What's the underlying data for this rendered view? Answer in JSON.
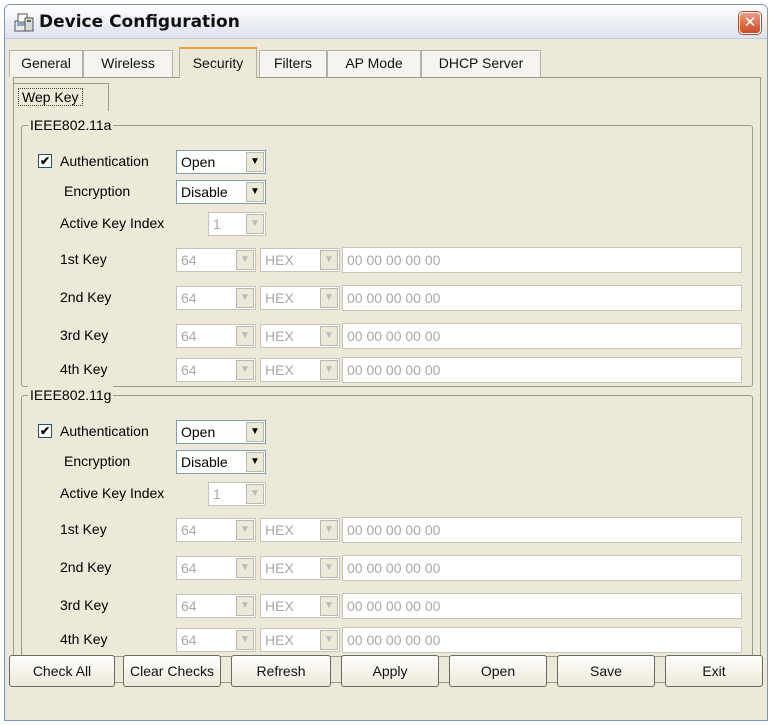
{
  "window": {
    "title": "Device Configuration"
  },
  "tabs": [
    "General",
    "Wireless",
    "Security",
    "Filters",
    "AP Mode",
    "DHCP Server"
  ],
  "active_tab": "Security",
  "subtab": "Wep Key",
  "groups": [
    {
      "title": "IEEE802.11a",
      "authentication_label": "Authentication",
      "authentication_checked": true,
      "authentication_value": "Open",
      "encryption_label": "Encryption",
      "encryption_value": "Disable",
      "active_key_index_label": "Active Key Index",
      "active_key_index_value": "1",
      "keys": [
        {
          "label": "1st Key",
          "length": "64",
          "format": "HEX",
          "value": "00 00 00 00 00"
        },
        {
          "label": "2nd Key",
          "length": "64",
          "format": "HEX",
          "value": "00 00 00 00 00"
        },
        {
          "label": "3rd Key",
          "length": "64",
          "format": "HEX",
          "value": "00 00 00 00 00"
        },
        {
          "label": "4th Key",
          "length": "64",
          "format": "HEX",
          "value": "00 00 00 00 00"
        }
      ]
    },
    {
      "title": "IEEE802.11g",
      "authentication_label": "Authentication",
      "authentication_checked": true,
      "authentication_value": "Open",
      "encryption_label": "Encryption",
      "encryption_value": "Disable",
      "active_key_index_label": "Active Key Index",
      "active_key_index_value": "1",
      "keys": [
        {
          "label": "1st Key",
          "length": "64",
          "format": "HEX",
          "value": "00 00 00 00 00"
        },
        {
          "label": "2nd Key",
          "length": "64",
          "format": "HEX",
          "value": "00 00 00 00 00"
        },
        {
          "label": "3rd Key",
          "length": "64",
          "format": "HEX",
          "value": "00 00 00 00 00"
        },
        {
          "label": "4th Key",
          "length": "64",
          "format": "HEX",
          "value": "00 00 00 00 00"
        }
      ]
    }
  ],
  "buttons": [
    "Check All",
    "Clear Checks",
    "Refresh",
    "Apply",
    "Open",
    "Save",
    "Exit"
  ],
  "icons": {
    "app": "device-config-icon",
    "close": "close-icon",
    "dropdown": "chevron-down-icon",
    "check": "check-icon"
  },
  "colors": {
    "close_button": "#cf4a2a",
    "active_tab_highlight": "#e8a33c",
    "window_face": "#ece9d8"
  }
}
